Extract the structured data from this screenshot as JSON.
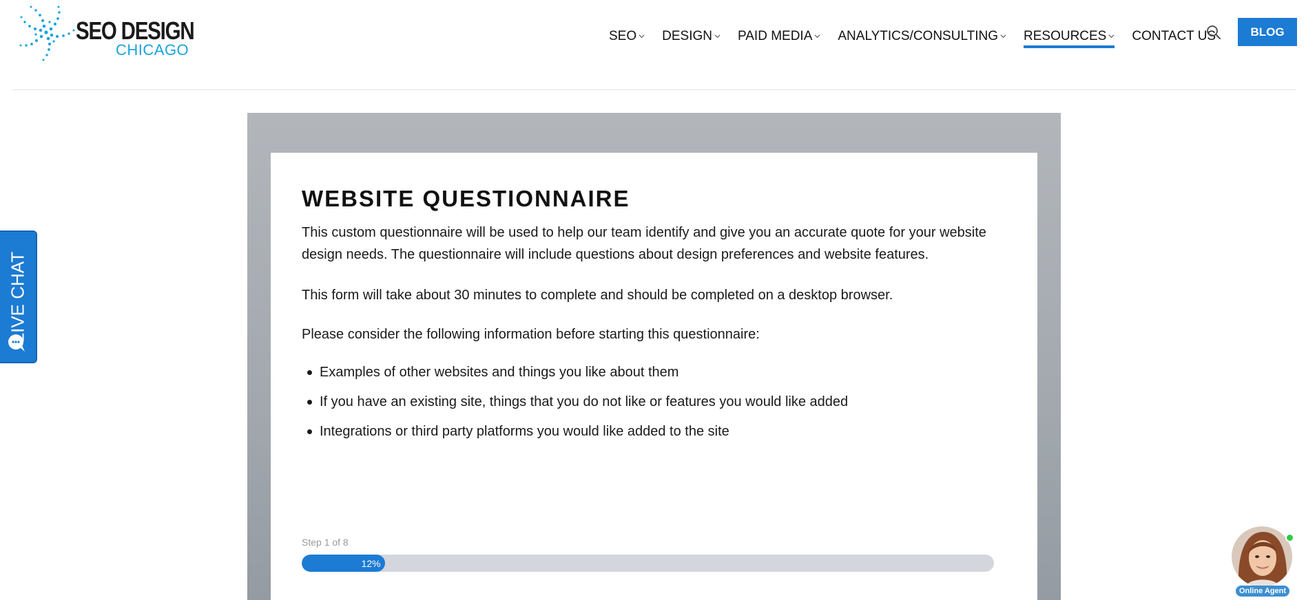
{
  "brand": {
    "name_line1": "SEO DESIGN",
    "name_line2": "CHICAGO",
    "logo_icon": "spiral-dots-logo",
    "colors": {
      "accent": "#1c7bd3",
      "logo_blue": "#1aa3dc",
      "text": "#1a1a1a"
    }
  },
  "nav": {
    "items": [
      {
        "label": "SEO",
        "has_dropdown": true
      },
      {
        "label": "DESIGN",
        "has_dropdown": true
      },
      {
        "label": "PAID MEDIA",
        "has_dropdown": true
      },
      {
        "label": "ANALYTICS/CONSULTING",
        "has_dropdown": true
      },
      {
        "label": "RESOURCES",
        "has_dropdown": true,
        "active": true
      },
      {
        "label": "CONTACT US",
        "has_dropdown": false
      }
    ],
    "search_icon": "search-icon",
    "blog_label": "BLOG"
  },
  "live_chat": {
    "label": "LIVE CHAT",
    "icon": "chat-bubble-icon"
  },
  "questionnaire": {
    "title": "WEBSITE QUESTIONNAIRE",
    "intro": "This custom questionnaire will be used to help our team identify and give you an accurate quote for your website design needs. The questionnaire will include questions about design preferences and website features.",
    "duration_note": "This form will take about 30 minutes to complete and should be completed on a desktop browser.",
    "consider_note": "Please consider the following information before starting this questionnaire:",
    "considerations": [
      "Examples of other websites and things you like about them",
      "If you have an existing site, things that you do not like or features you would like added",
      "Integrations or third party platforms you would like added to the site"
    ],
    "step_label": "Step 1 of 8",
    "progress_percent": 12,
    "progress_label": "12%"
  },
  "agent_widget": {
    "label": "Online Agent",
    "status": "online"
  }
}
